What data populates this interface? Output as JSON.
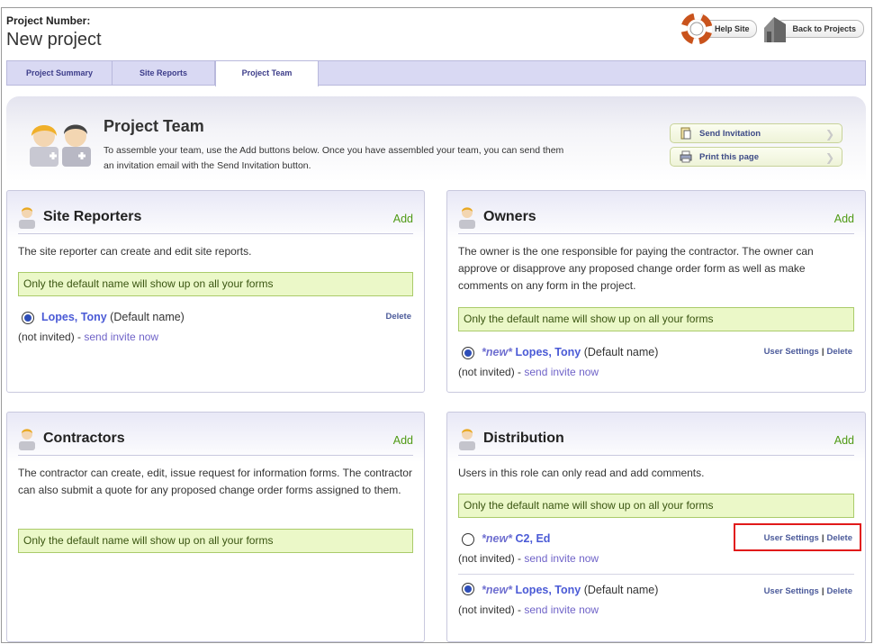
{
  "header": {
    "project_number_label": "Project Number:",
    "project_name": "New project",
    "help_site": "Help Site",
    "back_to_projects": "Back to Projects"
  },
  "tabs": [
    {
      "label": "Project Summary",
      "active": false
    },
    {
      "label": "Site Reports",
      "active": false
    },
    {
      "label": "Project Team",
      "active": true
    }
  ],
  "banner": {
    "title": "Project Team",
    "text": "To assemble your team, use the Add buttons below. Once you have assembled your team, you can send them an invitation email with the Send Invitation button.",
    "send_invitation": "Send Invitation",
    "print_page": "Print this page"
  },
  "common": {
    "add": "Add",
    "notice": "Only the default name will show up on all your forms",
    "default_name": "(Default name)",
    "not_invited": "(not invited) - ",
    "send_invite": "send invite now",
    "new_tag": "*new*",
    "user_settings": "User Settings",
    "delete": "Delete",
    "separator": "|"
  },
  "panels": {
    "site_reporters": {
      "title": "Site Reporters",
      "description": "The site reporter can create and edit site reports.",
      "members": [
        {
          "name": "Lopes, Tony",
          "selected": true,
          "new": false,
          "default": true
        }
      ]
    },
    "owners": {
      "title": "Owners",
      "description": "The owner is the one responsible for paying the contractor. The owner can approve or disapprove any proposed change order form as well as make comments on any form in the project.",
      "members": [
        {
          "name": "Lopes, Tony",
          "selected": true,
          "new": true,
          "default": true
        }
      ]
    },
    "contractors": {
      "title": "Contractors",
      "description": "The contractor can create, edit, issue request for information forms. The contractor can also submit a quote for any proposed change order forms assigned to them.",
      "members": []
    },
    "distribution": {
      "title": "Distribution",
      "description": "Users in this role can only read and add comments.",
      "members": [
        {
          "name": "C2, Ed",
          "selected": false,
          "new": true,
          "default": false
        },
        {
          "name": "Lopes, Tony",
          "selected": true,
          "new": true,
          "default": true
        }
      ]
    }
  },
  "colors": {
    "accent_green": "#4f9a14",
    "link_blue": "#4a5ad6",
    "notice_bg": "#ebf8c8",
    "tab_bar": "#d9d9f3",
    "highlight_red": "#e11a1a"
  },
  "icons": {
    "help": "lifebuoy-icon",
    "back": "house-icon",
    "team": "team-people-icon",
    "send": "document-send-icon",
    "print": "printer-icon",
    "panel": "person-icon"
  }
}
